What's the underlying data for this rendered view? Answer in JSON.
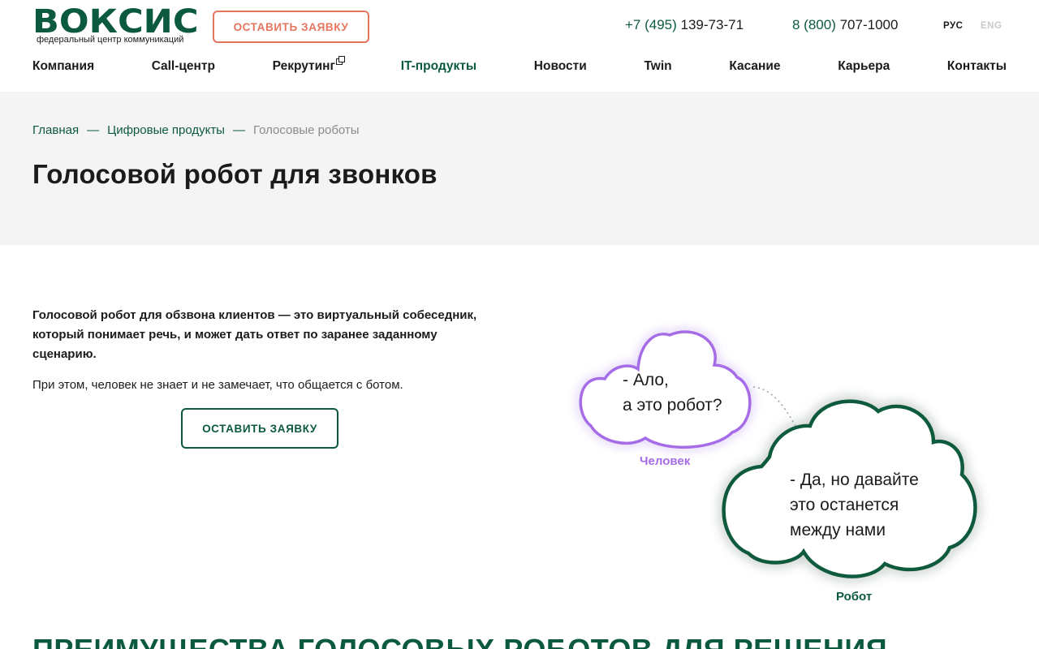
{
  "header": {
    "logo": {
      "word": "ВОКСИС",
      "subtitle": "федеральный центр коммуникаций"
    },
    "cta_label": "ОСТАВИТЬ ЗАЯВКУ",
    "phones": [
      {
        "code": "+7 (495)",
        "number": " 139-73-71"
      },
      {
        "code": "8 (800)",
        "number": " 707-1000"
      }
    ],
    "lang": {
      "ru": "РУС",
      "en": "ENG"
    }
  },
  "nav": {
    "items": [
      {
        "label": "Компания"
      },
      {
        "label": "Call-центр"
      },
      {
        "label": "Рекрутинг"
      },
      {
        "label": "IT-продукты"
      },
      {
        "label": "Новости"
      },
      {
        "label": "Twin"
      },
      {
        "label": "Касание"
      },
      {
        "label": "Карьера"
      },
      {
        "label": "Контакты"
      }
    ]
  },
  "breadcrumb": {
    "home": "Главная",
    "separator": "—",
    "section": "Цифровые продукты",
    "current": "Голосовые роботы"
  },
  "page": {
    "title": "Голосовой робот для звонков",
    "intro_bold": "Голосовой робот для обзвона клиентов — это виртуальный собеседник, который понимает речь, и может дать ответ по заранее заданному сценарию.",
    "intro_regular": "При этом, человек не знает и не замечает, что общается с ботом.",
    "cta_label": "ОСТАВИТЬ ЗАЯВКУ",
    "section_title": "ПРЕИМУЩЕСТВА ГОЛОСОВЫХ РОБОТОВ ДЛЯ РЕШЕНИЯ"
  },
  "dialog": {
    "human_line1": "- Ало,",
    "human_line2": "а это робот?",
    "human_label": "Человек",
    "robot_line1": "- Да, но давайте",
    "robot_line2": "это останется",
    "robot_line3": "между нами",
    "robot_label": "Робот"
  },
  "colors": {
    "brand_green": "#0c5a3e",
    "cta_coral": "#e6755e",
    "human_purple": "#a66ce8"
  }
}
